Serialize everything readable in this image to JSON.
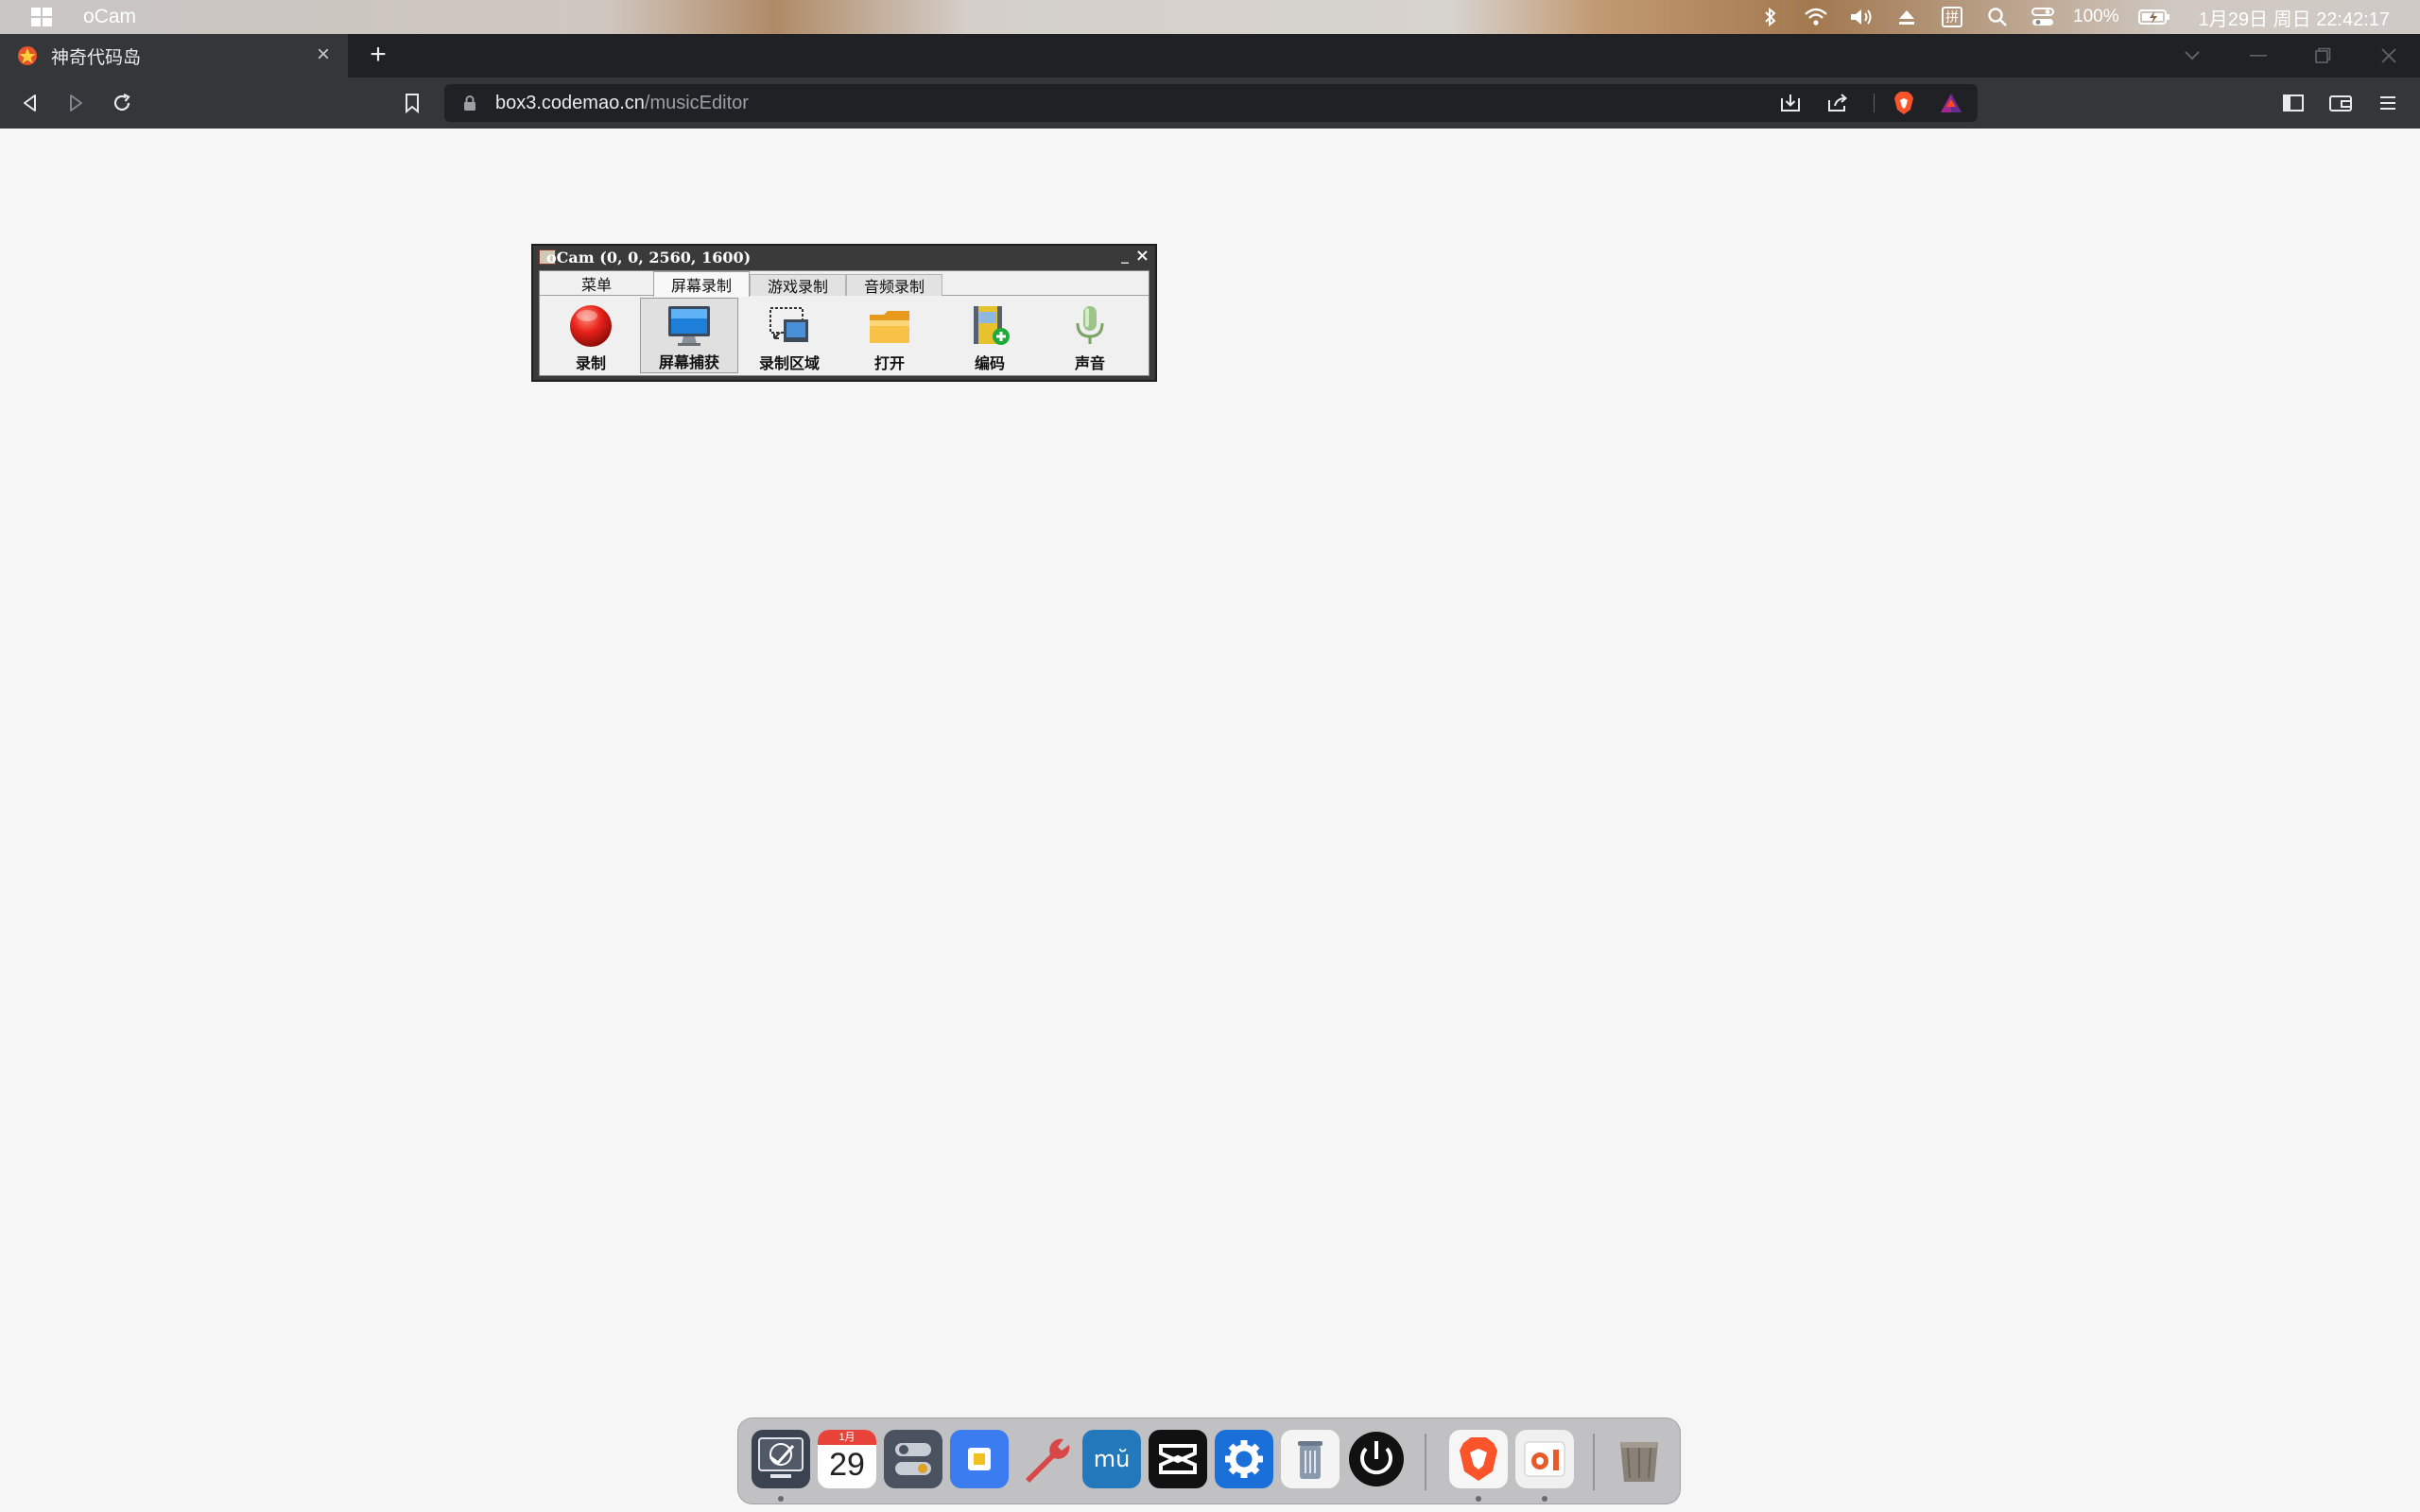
{
  "system_bar": {
    "app_name": "oCam",
    "battery": "100%",
    "input_method": "拼",
    "clock": "1月29日 周日 22:42:17"
  },
  "browser": {
    "tab_title": "神奇代码岛",
    "url_host": "box3.codemao.cn",
    "url_path": "/musicEditor"
  },
  "ocam": {
    "title": "oCam (0, 0, 2560, 1600)",
    "minimize": "_",
    "close": "×",
    "tabs": [
      "菜单",
      "屏幕录制",
      "游戏录制",
      "音频录制"
    ],
    "active_tab": "屏幕录制",
    "tools": [
      "录制",
      "屏幕捕获",
      "录制区域",
      "打开",
      "编码",
      "声音"
    ],
    "active_tool": "屏幕捕获"
  },
  "dock": {
    "calendar_month": "1月",
    "calendar_day": "29",
    "items": [
      "deepin-desktop",
      "calendar",
      "control-center",
      "app-store",
      "dev-tools",
      "mu-editor",
      "capcut",
      "settings",
      "trash-can-files",
      "power",
      "brave-browser",
      "ocam",
      "trash"
    ]
  }
}
